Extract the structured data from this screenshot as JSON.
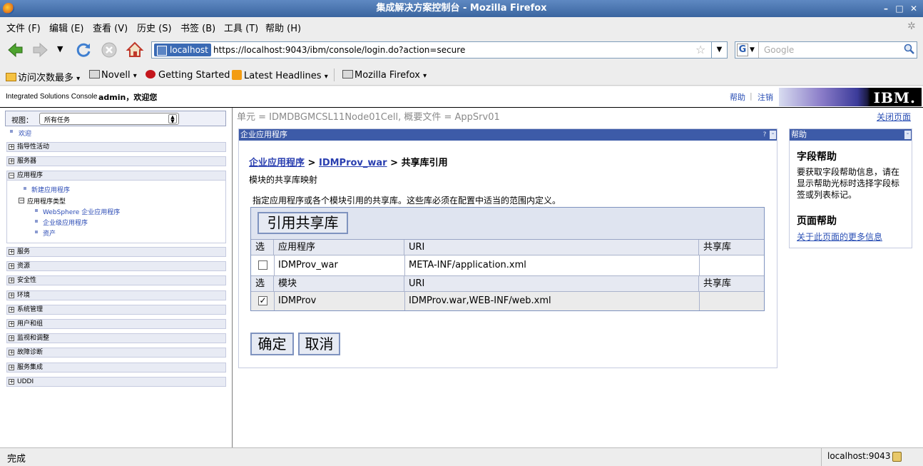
{
  "window": {
    "title": "集成解决方案控制台 - Mozilla Firefox"
  },
  "menu": [
    "文件 (F)",
    "编辑 (E)",
    "查看 (V)",
    "历史 (S)",
    "书签 (B)",
    "工具 (T)",
    "帮助 (H)"
  ],
  "nav": {
    "url_identity": "localhost",
    "url": "https://localhost:9043/ibm/console/login.do?action=secure",
    "search_placeholder": "Google"
  },
  "bookmarks": [
    "访问次数最多",
    "Novell",
    "Getting Started",
    "Latest Headlines",
    "Mozilla Firefox"
  ],
  "header": {
    "app_name": "Integrated Solutions Console",
    "welcome": "admin，欢迎您",
    "help": "帮助",
    "separator": "|",
    "logout": "注销",
    "logo": "IBM."
  },
  "leftnav": {
    "view_label": "视图：",
    "view_value": "所有任务",
    "welcome": "欢迎",
    "sections": [
      "指导性活动",
      "服务器",
      "应用程序"
    ],
    "app_children": {
      "new_app": "新建应用程序",
      "types": "应用程序类型",
      "websphere_app": "WebSphere 企业应用程序",
      "enterprise_app": "企业级应用程序",
      "assets": "资产"
    },
    "sections_after": [
      "服务",
      "资源",
      "安全性",
      "环境",
      "系统管理",
      "用户和组",
      "监视和调整",
      "故障诊断",
      "服务集成",
      "UDDI"
    ]
  },
  "main": {
    "scope": "单元 = IDMDBGMCSL11Node01Cell, 概要文件 = AppSrv01",
    "close_page": "关闭页面",
    "panel_title": "企业应用程序",
    "panel_question": "?",
    "panel_minimize": "-",
    "breadcrumb": {
      "root": "企业应用程序",
      "sep1": ">",
      "app": "IDMProv_war",
      "sep2": ">",
      "current": "共享库引用"
    },
    "subtitle": "模块的共享库映射",
    "description": "指定应用程序或各个模块引用的共享库。这些库必须在配置中适当的范围内定义。",
    "ref_button": "引用共享库",
    "table": {
      "app_headers": [
        "选择",
        "应用程序",
        "URI",
        "共享库"
      ],
      "app_row": {
        "checked": false,
        "name": "IDMProv_war",
        "uri": "META-INF/application.xml",
        "lib": ""
      },
      "module_headers": [
        "选择",
        "模块",
        "URI",
        "共享库"
      ],
      "module_row": {
        "checked": true,
        "name": "IDMProv",
        "uri": "IDMProv.war,WEB-INF/web.xml",
        "lib": ""
      }
    },
    "ok": "确定",
    "cancel": "取消"
  },
  "help": {
    "title": "帮助",
    "minimize": "-",
    "field_help_title": "字段帮助",
    "field_help_text": "要获取字段帮助信息，请在显示帮助光标时选择字段标签或列表标记。",
    "page_help_title": "页面帮助",
    "page_help_link": "关于此页面的更多信息"
  },
  "status": {
    "text": "完成",
    "host": "localhost:9043"
  }
}
